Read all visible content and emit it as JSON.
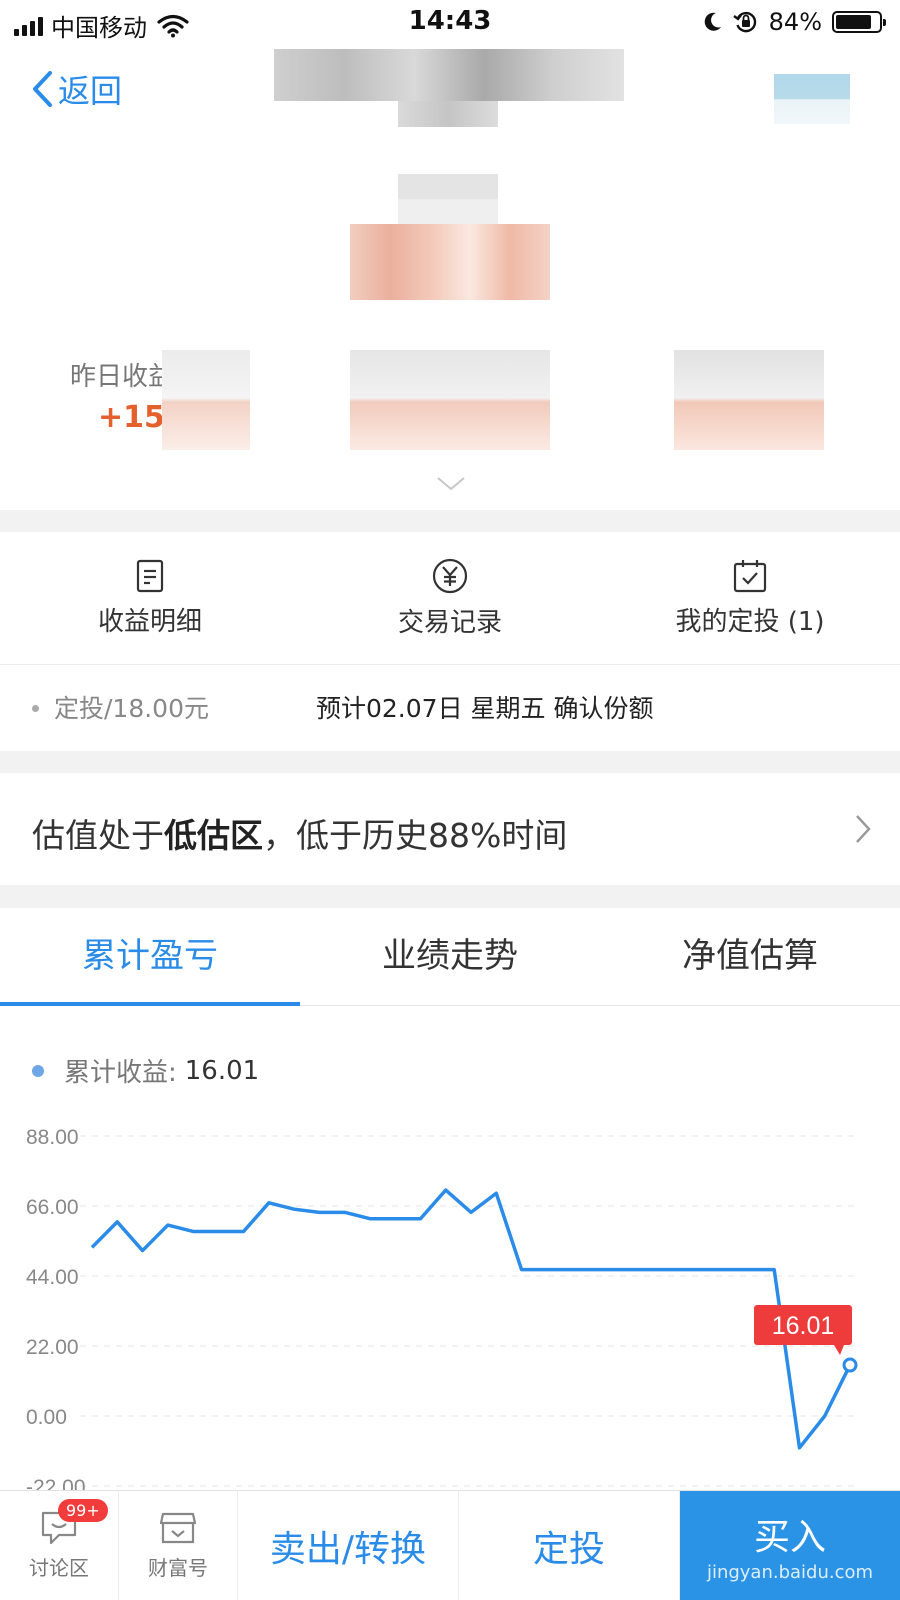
{
  "status_bar": {
    "carrier": "中国移动",
    "time": "14:43",
    "battery": "84%",
    "battery_level": 0.84
  },
  "nav": {
    "back_label": "返回"
  },
  "summary": {
    "yesterday_label": "昨日收益",
    "yesterday_value": "+15."
  },
  "actions": [
    {
      "label": "收益明细",
      "icon": "document-icon"
    },
    {
      "label": "交易记录",
      "icon": "yuan-icon"
    },
    {
      "label": "我的定投 (1)",
      "icon": "calendar-check-icon"
    }
  ],
  "dingtou": {
    "left": "定投/18.00元",
    "right": "预计02.07日 星期五 确认份额"
  },
  "valuation": {
    "prefix": "估值处于",
    "bold": "低估区",
    "suffix": "，低于历史88%时间"
  },
  "tabs": [
    {
      "label": "累计盈亏",
      "active": true
    },
    {
      "label": "业绩走势",
      "active": false
    },
    {
      "label": "净值估算",
      "active": false
    }
  ],
  "legend": {
    "label": "累计收益:",
    "value": "16.01"
  },
  "chart_data": {
    "type": "line",
    "yticks": [
      "88.00",
      "66.00",
      "44.00",
      "22.00",
      "0.00",
      "-22.00"
    ],
    "ylim": [
      -22,
      88
    ],
    "x": [
      0,
      1,
      2,
      3,
      4,
      5,
      6,
      7,
      8,
      9,
      10,
      11,
      12,
      13,
      14,
      15,
      16,
      17,
      18,
      19,
      20,
      21,
      22,
      23,
      24,
      25,
      26,
      27,
      28,
      29,
      30
    ],
    "series": [
      {
        "values": [
          53,
          61,
          52,
          60,
          58,
          58,
          58,
          67,
          65,
          64,
          64,
          62,
          62,
          62,
          71,
          64,
          70,
          46,
          46,
          46,
          46,
          46,
          46,
          46,
          46,
          46,
          46,
          46,
          -10,
          0,
          16.01
        ]
      }
    ],
    "tooltip": "16.01",
    "line_color": "#2a8ce8",
    "tooltip_color": "#ee3b3b"
  },
  "bottom_bar": {
    "discuss_label": "讨论区",
    "discuss_badge": "99+",
    "wealth_label": "财富号",
    "sell_label": "卖出/转换",
    "dingtou_label": "定投",
    "buy_label": "买入",
    "watermark": "jingyan.baidu.com"
  }
}
